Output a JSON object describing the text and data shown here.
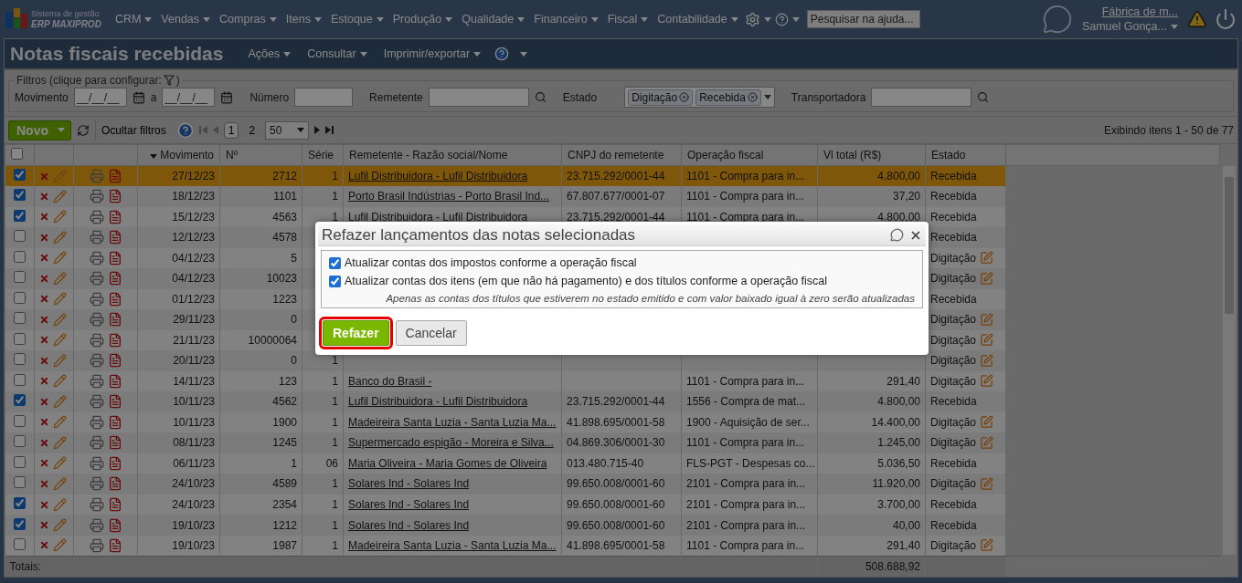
{
  "nav": {
    "logo_line1": "Sistema de gestão",
    "logo_line2": "ERP MAXIPROD",
    "menus": [
      "CRM",
      "Vendas",
      "Compras",
      "Itens",
      "Estoque",
      "Produção",
      "Qualidade",
      "Financeiro",
      "Fiscal",
      "Contabilidade"
    ],
    "search_placeholder": "Pesquisar na ajuda...",
    "company": "Fábrica de m...",
    "user": "Samuel Gonça..."
  },
  "page": {
    "title": "Notas fiscais recebidas",
    "menus": [
      "Ações",
      "Consultar",
      "Imprimir/exportar"
    ]
  },
  "filters": {
    "legend": "Filtros (clique para configurar:",
    "legend_end": ")",
    "movimento": {
      "label": "Movimento",
      "from_placeholder": "__/__/__",
      "separator": "a",
      "to_placeholder": "__/__/__"
    },
    "numero": {
      "label": "Número"
    },
    "remetente": {
      "label": "Remetente"
    },
    "estado": {
      "label": "Estado",
      "chips": [
        "Digitação",
        "Recebida"
      ]
    },
    "transportadora": {
      "label": "Transportadora"
    }
  },
  "toolbar": {
    "new": "Novo",
    "hide_filters": "Ocultar filtros",
    "pages": [
      {
        "label": "1",
        "selected": true
      },
      {
        "label": "2",
        "selected": false
      }
    ],
    "page_size": "50",
    "summary": "Exibindo itens 1 - 50 de 77"
  },
  "table": {
    "all_checked": false,
    "columns": [
      {
        "label": "Movimento",
        "sorted": true
      },
      {
        "label": "Nº",
        "sorted": false
      },
      {
        "label": "Série",
        "sorted": false
      },
      {
        "label": "Remetente - Razão social/Nome",
        "sorted": false
      },
      {
        "label": "CNPJ do remetente",
        "sorted": false
      },
      {
        "label": "Operação fiscal",
        "sorted": false
      },
      {
        "label": "Vl total (R$)",
        "sorted": false
      },
      {
        "label": "Estado",
        "sorted": false
      }
    ],
    "rows": [
      {
        "checked": true,
        "selected": true,
        "movimento": "27/12/23",
        "numero": "2712",
        "serie": "1",
        "remetente": "Lufil Distribuidora - Lufil Distribuidora",
        "cnpj": "23.715.292/0001-44",
        "operacao": "1101 - Compra para in...",
        "total": "4.800,00",
        "estado": "Recebida",
        "editable": false
      },
      {
        "checked": true,
        "selected": false,
        "movimento": "18/12/23",
        "numero": "1101",
        "serie": "1",
        "remetente": "Porto Brasil Indústrias - Porto Brasil Ind...",
        "cnpj": "67.807.677/0001-07",
        "operacao": "1101 - Compra para in...",
        "total": "37,20",
        "estado": "Recebida",
        "editable": false
      },
      {
        "checked": true,
        "selected": false,
        "movimento": "15/12/23",
        "numero": "4563",
        "serie": "1",
        "remetente": "Lufil Distribuidora - Lufil Distribuidora",
        "cnpj": "23.715.292/0001-44",
        "operacao": "1101 - Compra para in...",
        "total": "4.800,00",
        "estado": "Recebida",
        "editable": false
      },
      {
        "checked": false,
        "selected": false,
        "movimento": "12/12/23",
        "numero": "4578",
        "estado": "Recebida",
        "editable": false
      },
      {
        "checked": false,
        "selected": false,
        "movimento": "04/12/23",
        "numero": "5",
        "estado": "Digitação",
        "editable": true
      },
      {
        "checked": false,
        "selected": false,
        "movimento": "04/12/23",
        "numero": "10023",
        "estado": "Digitação",
        "editable": true
      },
      {
        "checked": false,
        "selected": false,
        "movimento": "01/12/23",
        "numero": "1223",
        "estado": "Recebida",
        "editable": false
      },
      {
        "checked": false,
        "selected": false,
        "movimento": "29/11/23",
        "numero": "0",
        "estado": "Digitação",
        "editable": true
      },
      {
        "checked": false,
        "selected": false,
        "movimento": "21/11/23",
        "numero": "10000064",
        "estado": "Digitação",
        "editable": true
      },
      {
        "checked": false,
        "selected": false,
        "movimento": "20/11/23",
        "numero": "0",
        "serie": "1",
        "estado": "Digitação",
        "editable": true
      },
      {
        "checked": false,
        "selected": false,
        "movimento": "14/11/23",
        "numero": "123",
        "serie": "1",
        "remetente": "Banco do Brasil -",
        "operacao": "1101 - Compra para in...",
        "total": "291,40",
        "estado": "Digitação",
        "editable": true
      },
      {
        "checked": true,
        "selected": false,
        "movimento": "10/11/23",
        "numero": "4562",
        "serie": "1",
        "remetente": "Lufil Distribuidora - Lufil Distribuidora",
        "cnpj": "23.715.292/0001-44",
        "operacao": "1556 - Compra de mat...",
        "total": "4.800,00",
        "estado": "Recebida",
        "editable": false
      },
      {
        "checked": false,
        "selected": false,
        "movimento": "10/11/23",
        "numero": "1900",
        "serie": "1",
        "remetente": "Madeireira Santa Luzia - Santa Luzia Ma...",
        "cnpj": "41.898.695/0001-58",
        "operacao": "1900 - Aquisição de ser...",
        "total": "14.400,00",
        "estado": "Digitação",
        "editable": true
      },
      {
        "checked": false,
        "selected": false,
        "movimento": "08/11/23",
        "numero": "1245",
        "serie": "1",
        "remetente": "Supermercado espigão - Moreira e Silva...",
        "cnpj": "04.869.306/0001-30",
        "operacao": "1101 - Compra para in...",
        "total": "1.245,00",
        "estado": "Digitação",
        "editable": true
      },
      {
        "checked": false,
        "selected": false,
        "movimento": "06/11/23",
        "numero": "1",
        "serie": "06",
        "remetente": "Maria Oliveira - Maria Gomes de Oliveira",
        "cnpj": "013.480.715-40",
        "operacao": "FLS-PGT - Despesas co...",
        "total": "5.036,50",
        "estado": "Recebida",
        "editable": false
      },
      {
        "checked": false,
        "selected": false,
        "movimento": "24/10/23",
        "numero": "4589",
        "serie": "1",
        "remetente": "Solares Ind - Solares Ind",
        "cnpj": "99.650.008/0001-60",
        "operacao": "2101 - Compra para in...",
        "total": "11.920,00",
        "estado": "Digitação",
        "editable": true
      },
      {
        "checked": true,
        "selected": false,
        "movimento": "24/10/23",
        "numero": "2354",
        "serie": "1",
        "remetente": "Solares Ind - Solares Ind",
        "cnpj": "99.650.008/0001-60",
        "operacao": "2101 - Compra para in...",
        "total": "3.700,00",
        "estado": "Recebida",
        "editable": false
      },
      {
        "checked": true,
        "selected": false,
        "movimento": "19/10/23",
        "numero": "1212",
        "serie": "1",
        "remetente": "Solares Ind - Solares Ind",
        "cnpj": "99.650.008/0001-60",
        "operacao": "2101 - Compra para in...",
        "total": "40,00",
        "estado": "Recebida",
        "editable": false
      },
      {
        "checked": false,
        "selected": false,
        "movimento": "19/10/23",
        "numero": "1987",
        "serie": "1",
        "remetente": "Madeireira Santa Luzia - Santa Luzia Ma...",
        "cnpj": "41.898.695/0001-58",
        "operacao": "1101 - Compra para in...",
        "total": "291,40",
        "estado": "Digitação",
        "editable": true
      }
    ],
    "totals": {
      "label": "Totais:",
      "value": "508.688,92"
    }
  },
  "dialog": {
    "title": "Refazer lançamentos das notas selecionadas",
    "options": [
      {
        "label": "Atualizar contas dos impostos conforme a operação fiscal",
        "checked": true
      },
      {
        "label": "Atualizar contas dos itens (em que não há pagamento) e dos títulos conforme a operação fiscal",
        "checked": true,
        "note": "Apenas as contas dos títulos que estiverem no estado emitido e com valor baixado igual à zero serão atualizadas"
      }
    ],
    "buttons": [
      {
        "label": "Refazer",
        "kind": "primary",
        "highlighted": true
      },
      {
        "label": "Cancelar",
        "kind": "secondary",
        "highlighted": false
      }
    ]
  }
}
